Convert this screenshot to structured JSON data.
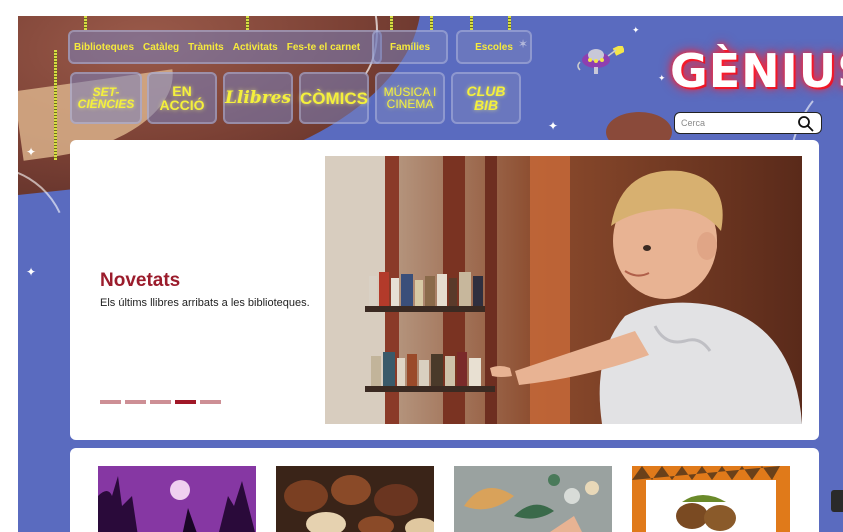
{
  "nav": {
    "items": [
      "Biblioteques",
      "Catàleg",
      "Tràmits",
      "Activitats",
      "Fes-te el carnet"
    ],
    "families": "Famílies",
    "schools": "Escoles"
  },
  "categories": [
    {
      "label": "SET-CIÈNCIES"
    },
    {
      "label": "EN ACCIÓ"
    },
    {
      "label": "Llibres"
    },
    {
      "label": "CÒMICS"
    },
    {
      "label": "MÚSICA I CINEMA"
    },
    {
      "label": "CLUB BIB"
    }
  ],
  "brand": {
    "logo": "GÈNIUS"
  },
  "search": {
    "placeholder": "Cerca"
  },
  "hero": {
    "title": "Novetats",
    "subtitle": "Els últims llibres arribats a les biblioteques.",
    "slides": 5,
    "active_slide": 4
  },
  "colors": {
    "background": "#5a6bbf",
    "nav_text": "#f6ea3c",
    "hero_title": "#9b1c2c",
    "dot_active": "#a01827",
    "dot_inactive": "#cd8f95"
  }
}
